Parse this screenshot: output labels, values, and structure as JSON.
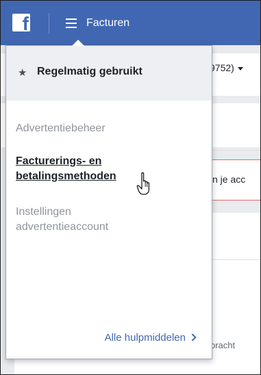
{
  "topbar": {
    "logo_letter": "f",
    "title": "Facturen"
  },
  "background": {
    "account_selector": "9752)",
    "alert_text": "n je acc",
    "bottom_text": "bracht"
  },
  "dropdown": {
    "frequent_label": "Regelmatig gebruikt",
    "items": [
      {
        "label": "Advertentiebeheer"
      },
      {
        "label_line1": "Facturerings- en",
        "label_line2": "betalingsmethoden"
      },
      {
        "label_line1": "Instellingen",
        "label_line2": "advertentieaccount"
      }
    ],
    "all_tools_label": "Alle hulpmiddelen"
  },
  "icons": {
    "logo": "facebook-logo-icon",
    "menu": "hamburger-menu-icon",
    "star": "star-icon",
    "chevron": "chevron-right-icon",
    "cursor": "hand-pointer-cursor-icon"
  },
  "colors": {
    "brand_blue": "#4267b2",
    "page_bg": "#e9ebee",
    "alert_border": "#e9646f",
    "link": "#4267b2",
    "muted_text": "#90949c"
  }
}
